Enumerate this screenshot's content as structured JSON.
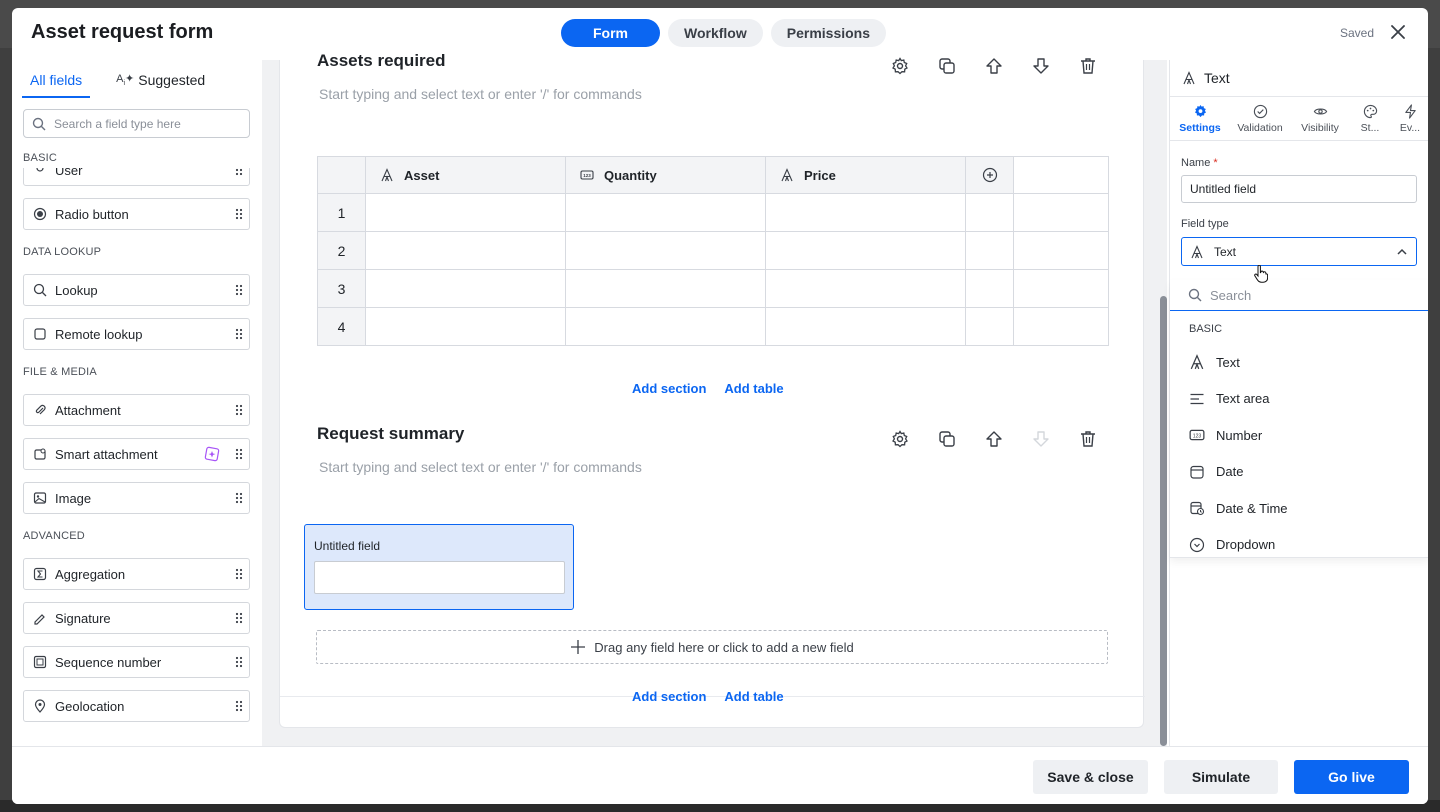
{
  "header": {
    "title": "Asset request form",
    "tabs": [
      "Form",
      "Workflow",
      "Permissions"
    ],
    "active_tab": "Form",
    "save_status": "Saved"
  },
  "sidebar": {
    "tabs": [
      "All fields",
      "Suggested"
    ],
    "search_placeholder": "Search a field type here",
    "categories": [
      {
        "label": "BASIC",
        "items": [
          "User",
          "Radio button"
        ]
      },
      {
        "label": "DATA LOOKUP",
        "items": [
          "Lookup",
          "Remote lookup"
        ]
      },
      {
        "label": "FILE & MEDIA",
        "items": [
          "Attachment",
          "Smart attachment",
          "Image"
        ]
      },
      {
        "label": "ADVANCED",
        "items": [
          "Aggregation",
          "Signature",
          "Sequence number",
          "Geolocation"
        ]
      }
    ]
  },
  "canvas": {
    "section1": {
      "title": "Assets required",
      "description_placeholder": "Start typing and select text or enter '/' for commands",
      "table": {
        "columns": [
          "Asset",
          "Quantity",
          "Price"
        ],
        "rows": [
          "1",
          "2",
          "3",
          "4"
        ]
      }
    },
    "add_section": "Add section",
    "add_table": "Add table",
    "section2": {
      "title": "Request summary",
      "description_placeholder": "Start typing and select text or enter '/' for commands",
      "field_label": "Untitled field"
    },
    "dropzone_text": "Drag any field here or click to add a new field"
  },
  "properties": {
    "header": "Text",
    "tabs": [
      "Settings",
      "Validation",
      "Visibility",
      "St...",
      "Ev..."
    ],
    "active_tab": "Settings",
    "name_label": "Name",
    "name_value": "Untitled field",
    "field_type_label": "Field type",
    "field_type_value": "Text",
    "dropdown": {
      "search_placeholder": "Search",
      "category": "BASIC",
      "options": [
        "Text",
        "Text area",
        "Number",
        "Date",
        "Date & Time",
        "Dropdown"
      ]
    }
  },
  "footer": {
    "save_close": "Save & close",
    "simulate": "Simulate",
    "go_live": "Go live"
  },
  "colors": {
    "primary": "#0b66f2",
    "selected_field_bg": "#dde8fb",
    "canvas_bg": "#f0f1f3"
  }
}
